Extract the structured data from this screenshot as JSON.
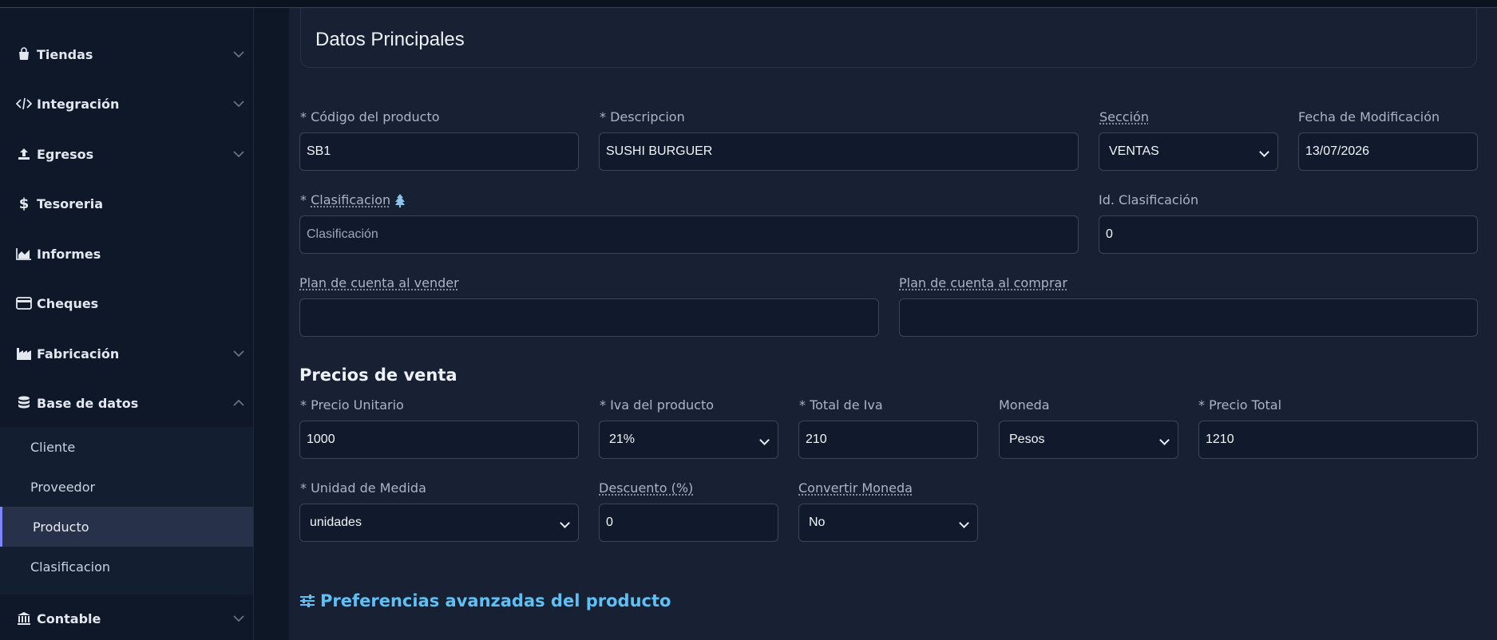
{
  "sidebar": {
    "items": [
      {
        "label": "Tiendas",
        "icon": "bag-icon"
      },
      {
        "label": "Integración",
        "icon": "code-icon"
      },
      {
        "label": "Egresos",
        "icon": "upload-icon"
      },
      {
        "label": "Tesoreria",
        "icon": "dollar-icon"
      },
      {
        "label": "Informes",
        "icon": "area-chart-icon"
      },
      {
        "label": "Cheques",
        "icon": "credit-card-icon"
      },
      {
        "label": "Fabricación",
        "icon": "factory-icon"
      },
      {
        "label": "Base de datos",
        "icon": "database-icon"
      },
      {
        "label": "Contable",
        "icon": "bank-icon"
      }
    ],
    "subitems": [
      {
        "label": "Cliente"
      },
      {
        "label": "Proveedor"
      },
      {
        "label": "Producto"
      },
      {
        "label": "Clasificacion"
      }
    ]
  },
  "card": {
    "title": "Datos Principales"
  },
  "form": {
    "codigo": {
      "label": "* Código del producto",
      "value": "SB1"
    },
    "descripcion": {
      "label": "* Descripcion",
      "value": "SUSHI BURGUER"
    },
    "seccion": {
      "label": "Sección",
      "value": "VENTAS"
    },
    "fecha": {
      "label": "Fecha de Modificación",
      "value": "13/07/2026"
    },
    "clasificacion": {
      "label": "* Clasificacion",
      "placeholder": "Clasificación"
    },
    "id_clasificacion": {
      "label": "Id. Clasificación",
      "value": "0"
    },
    "plan_vender": {
      "label": "Plan de cuenta al vender",
      "value": ""
    },
    "plan_comprar": {
      "label": "Plan de cuenta al comprar",
      "value": ""
    }
  },
  "precios": {
    "title": "Precios de venta",
    "precio_unitario": {
      "label": "* Precio Unitario",
      "value": "1000"
    },
    "iva": {
      "label": "* Iva del producto",
      "value": "21%"
    },
    "total_iva": {
      "label": "* Total de Iva",
      "value": "210"
    },
    "moneda": {
      "label": "Moneda",
      "value": "Pesos"
    },
    "precio_total": {
      "label": "* Precio Total",
      "value": "1210"
    },
    "unidad": {
      "label": "* Unidad de Medida",
      "value": "unidades"
    },
    "descuento": {
      "label": "Descuento (%)",
      "value": "0"
    },
    "convertir": {
      "label": "Convertir Moneda",
      "value": "No"
    }
  },
  "advanced": {
    "label": "Preferencias avanzadas del producto"
  }
}
